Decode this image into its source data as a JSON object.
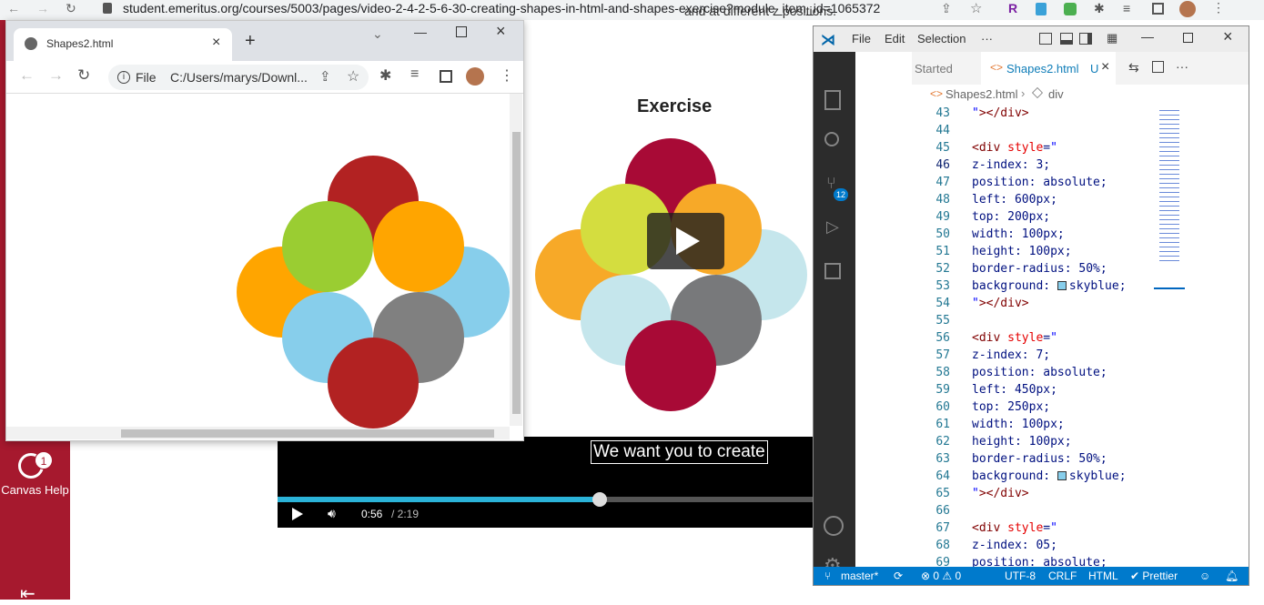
{
  "bg_browser": {
    "url": "student.emeritus.org/courses/5003/pages/video-2-4-2-5-6-30-creating-shapes-in-html-and-shapes-exercise?module_item_id=1065372",
    "snippet": "and at different z positions."
  },
  "canvas": {
    "help_label": "Canvas Help",
    "help_badge": "1"
  },
  "video": {
    "title": "Exercise",
    "caption": "We want you to create",
    "current_time": "0:56",
    "duration": "/ 2:19",
    "progress_fraction": 0.6,
    "circles": [
      {
        "color": "#a80a36"
      },
      {
        "color": "#f7a928"
      },
      {
        "color": "#c5e6ec"
      },
      {
        "color": "#d4dd3f"
      },
      {
        "color": "#f7a928"
      },
      {
        "color": "#c5e6ec"
      },
      {
        "color": "#78797b"
      },
      {
        "color": "#a80a36"
      }
    ]
  },
  "popup": {
    "tab_title": "Shapes2.html",
    "omnibox_scheme": "File",
    "omnibox_path": "C:/Users/marys/Downl...",
    "circles": [
      {
        "color": "#b22222"
      },
      {
        "color": "#ffa500"
      },
      {
        "color": "#87ceeb"
      },
      {
        "color": "#9acd32"
      },
      {
        "color": "#ffa500"
      },
      {
        "color": "#87ceeb"
      },
      {
        "color": "#808080"
      },
      {
        "color": "#b22222"
      }
    ]
  },
  "vscode": {
    "menu": [
      "File",
      "Edit",
      "Selection",
      "···"
    ],
    "tab_started": "Started",
    "tab_active": "Shapes2.html",
    "tab_active_state": "U",
    "breadcrumb_file": "Shapes2.html",
    "breadcrumb_node": "div",
    "scm_badge": "12",
    "lines": [
      {
        "n": "43",
        "text": "\"></div>"
      },
      {
        "n": "44",
        "text": ""
      },
      {
        "n": "45",
        "text": "<div style=\""
      },
      {
        "n": "46",
        "text": "z-index: 3;"
      },
      {
        "n": "47",
        "text": "position: absolute;"
      },
      {
        "n": "48",
        "text": "left: 600px;"
      },
      {
        "n": "49",
        "text": "top: 200px;"
      },
      {
        "n": "50",
        "text": "width: 100px;"
      },
      {
        "n": "51",
        "text": "height: 100px;"
      },
      {
        "n": "52",
        "text": "border-radius: 50%;"
      },
      {
        "n": "53",
        "text": "background: ■skyblue;"
      },
      {
        "n": "54",
        "text": "\"></div>"
      },
      {
        "n": "55",
        "text": ""
      },
      {
        "n": "56",
        "text": "<div style=\""
      },
      {
        "n": "57",
        "text": "z-index: 7;"
      },
      {
        "n": "58",
        "text": "position: absolute;"
      },
      {
        "n": "59",
        "text": "left: 450px;"
      },
      {
        "n": "60",
        "text": "top: 250px;"
      },
      {
        "n": "61",
        "text": "width: 100px;"
      },
      {
        "n": "62",
        "text": "height: 100px;"
      },
      {
        "n": "63",
        "text": "border-radius: 50%;"
      },
      {
        "n": "64",
        "text": "background: ■skyblue;"
      },
      {
        "n": "65",
        "text": "\"></div>"
      },
      {
        "n": "66",
        "text": ""
      },
      {
        "n": "67",
        "text": "<div style=\""
      },
      {
        "n": "68",
        "text": "z-index: 05;"
      },
      {
        "n": "69",
        "text": "position: absolute;"
      }
    ],
    "status": {
      "branch": "master*",
      "errors": "⊗ 0 ⚠ 0",
      "encoding": "UTF-8",
      "eol": "CRLF",
      "lang": "HTML",
      "formatter": "✔ Prettier"
    }
  }
}
